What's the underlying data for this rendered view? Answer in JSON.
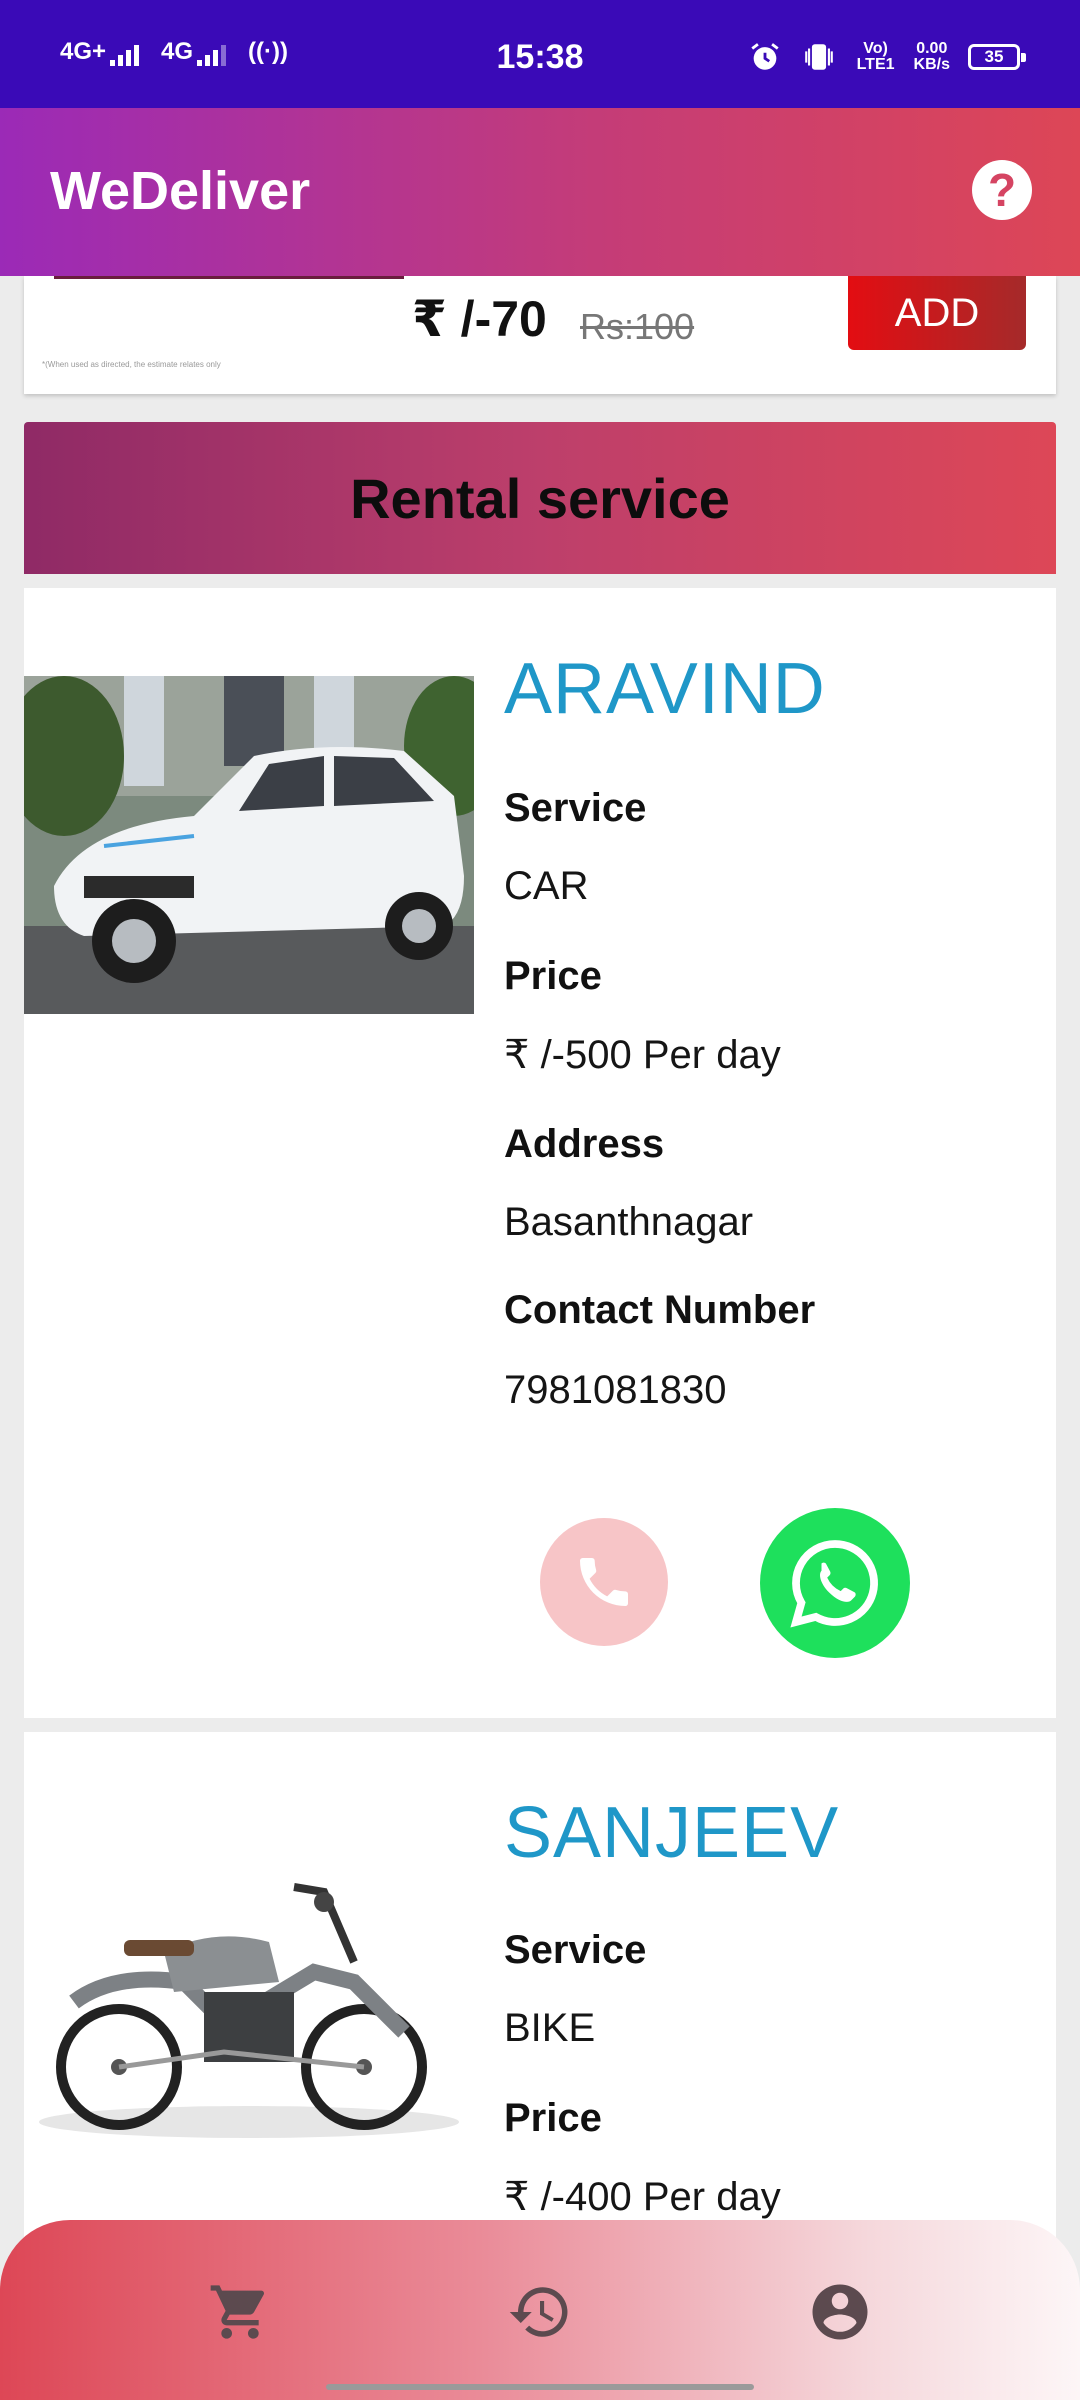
{
  "status_bar": {
    "net1": "4G+",
    "net2": "4G",
    "time": "15:38",
    "volte": "Vo) LTE1",
    "speed_value": "0.00",
    "speed_unit": "KB/s",
    "battery": "35"
  },
  "app_bar": {
    "title": "WeDeliver",
    "help_icon": "help-circle-icon"
  },
  "previous_item": {
    "price": "₹ /-70",
    "old_price": "Rs:100",
    "note": "*(When used as directed, the estimate relates only",
    "add_label": "ADD"
  },
  "section": {
    "title": "Rental service"
  },
  "services": [
    {
      "name": "ARAVIND",
      "image": "white-car-photo",
      "service_label": "Service",
      "service": "CAR",
      "price_label": "Price",
      "price": "₹ /-500 Per day",
      "address_label": "Address",
      "address": "Basanthnagar",
      "contact_label": "Contact Number",
      "contact": "7981081830"
    },
    {
      "name": "SANJEEV",
      "image": "motorcycle-photo",
      "service_label": "Service",
      "service": "BIKE",
      "price_label": "Price",
      "price": "₹ /-400 Per day"
    }
  ],
  "bottom_nav": {
    "items": [
      "cart-icon",
      "history-icon",
      "account-icon"
    ]
  },
  "colors": {
    "status_bar": "#3a0ab7",
    "name_blue": "#1f97c8",
    "add_red": "#e30d12",
    "whatsapp_green": "#1ee05c",
    "call_pink": "#f7c5c7"
  }
}
